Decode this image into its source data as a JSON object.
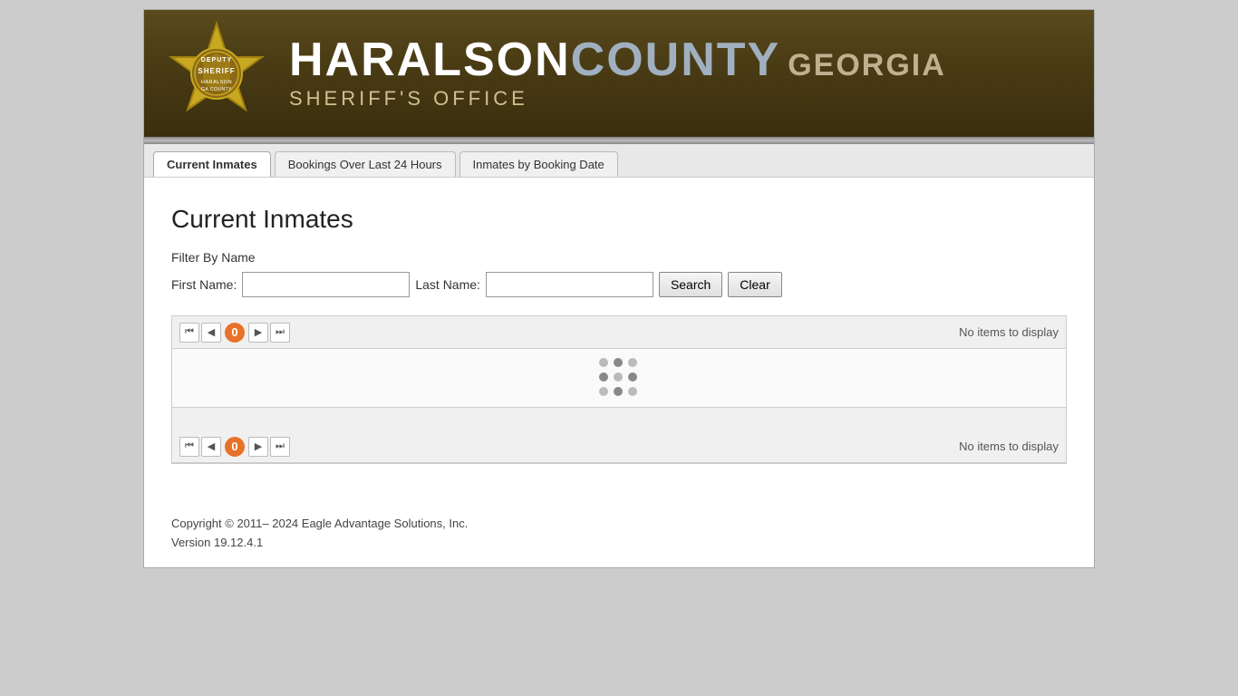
{
  "header": {
    "title_haralson": "HARALSON",
    "title_county": "COUNTY",
    "title_georgia": "GEORGIA",
    "subtitle": "SHERIFF'S OFFICE"
  },
  "tabs": {
    "tab1": "Current Inmates",
    "tab2": "Bookings Over Last 24 Hours",
    "tab3": "Inmates by Booking Date"
  },
  "main": {
    "page_title": "Current Inmates",
    "filter_label": "Filter By Name",
    "first_name_label": "First Name:",
    "last_name_label": "Last Name:",
    "search_btn": "Search",
    "clear_btn": "Clear",
    "first_name_value": "",
    "last_name_value": "",
    "no_items_text": "No items to display",
    "page_count": "0"
  },
  "footer": {
    "copyright": "Copyright © 2011– 2024 Eagle Advantage Solutions, Inc.",
    "version": "Version 19.12.4.1"
  }
}
